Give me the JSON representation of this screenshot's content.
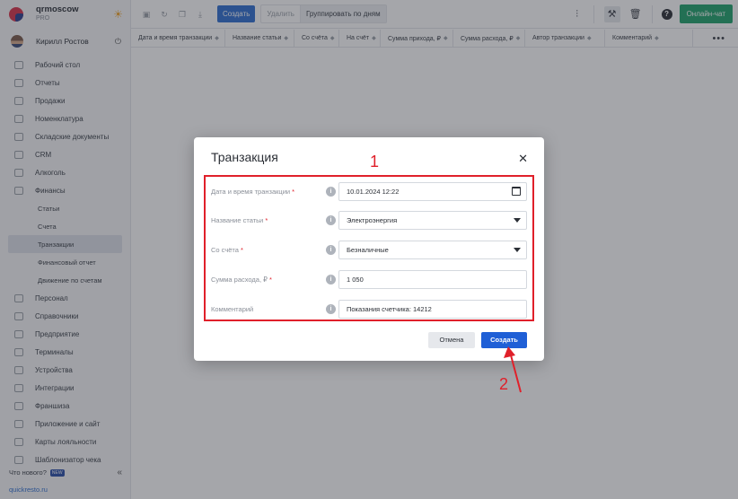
{
  "brand": {
    "name": "qrmoscow",
    "plan": "PRO"
  },
  "user": {
    "name": "Кирилл Ростов"
  },
  "sidebar": {
    "items": [
      {
        "label": "Рабочий стол"
      },
      {
        "label": "Отчеты"
      },
      {
        "label": "Продажи"
      },
      {
        "label": "Номенклатура"
      },
      {
        "label": "Складские документы"
      },
      {
        "label": "CRM"
      },
      {
        "label": "Алкоголь"
      },
      {
        "label": "Финансы"
      }
    ],
    "finance_sub": [
      {
        "label": "Статьи"
      },
      {
        "label": "Счета"
      },
      {
        "label": "Транзакции",
        "active": true
      },
      {
        "label": "Финансовый отчет"
      },
      {
        "label": "Движение по счетам"
      }
    ],
    "items2": [
      {
        "label": "Персонал"
      },
      {
        "label": "Справочники"
      },
      {
        "label": "Предприятие"
      },
      {
        "label": "Терминалы"
      },
      {
        "label": "Устройства"
      },
      {
        "label": "Интеграции"
      },
      {
        "label": "Франшиза"
      },
      {
        "label": "Приложение и сайт"
      },
      {
        "label": "Карты лояльности"
      },
      {
        "label": "Шаблонизатор чека"
      }
    ],
    "whats_new": "Что нового?",
    "new_badge": "NEW",
    "footer_link": "quickresto.ru"
  },
  "toolbar": {
    "create_label": "Создать",
    "delete_label": "Удалить",
    "group_label": "Группировать по дням",
    "chat_label": "Онлайн-чат"
  },
  "table": {
    "columns": [
      "Дата и время транзакции",
      "Название статьи",
      "Со счёта",
      "На счёт",
      "Сумма прихода, ₽",
      "Сумма расхода, ₽",
      "Автор транзакции",
      "Комментарий"
    ]
  },
  "modal": {
    "title": "Транзакция",
    "fields": [
      {
        "label": "Дата и время транзакции",
        "required": "*",
        "value": "10.01.2024 12:22"
      },
      {
        "label": "Название статьи",
        "required": "*",
        "value": "Электроэнергия"
      },
      {
        "label": "Со счёта",
        "required": "*",
        "value": "Безналичные"
      },
      {
        "label": "Сумма расхода, ₽",
        "required": "*",
        "value": "1 050"
      },
      {
        "label": "Комментарий",
        "required": "",
        "value": "Показания счетчика: 14212"
      }
    ],
    "cancel_label": "Отмена",
    "create_label": "Создать"
  },
  "annotations": {
    "one": "1",
    "two": "2"
  },
  "colors": {
    "accent": "#1f5fd6",
    "chat": "#20a36b",
    "annotation": "#e0202a"
  }
}
